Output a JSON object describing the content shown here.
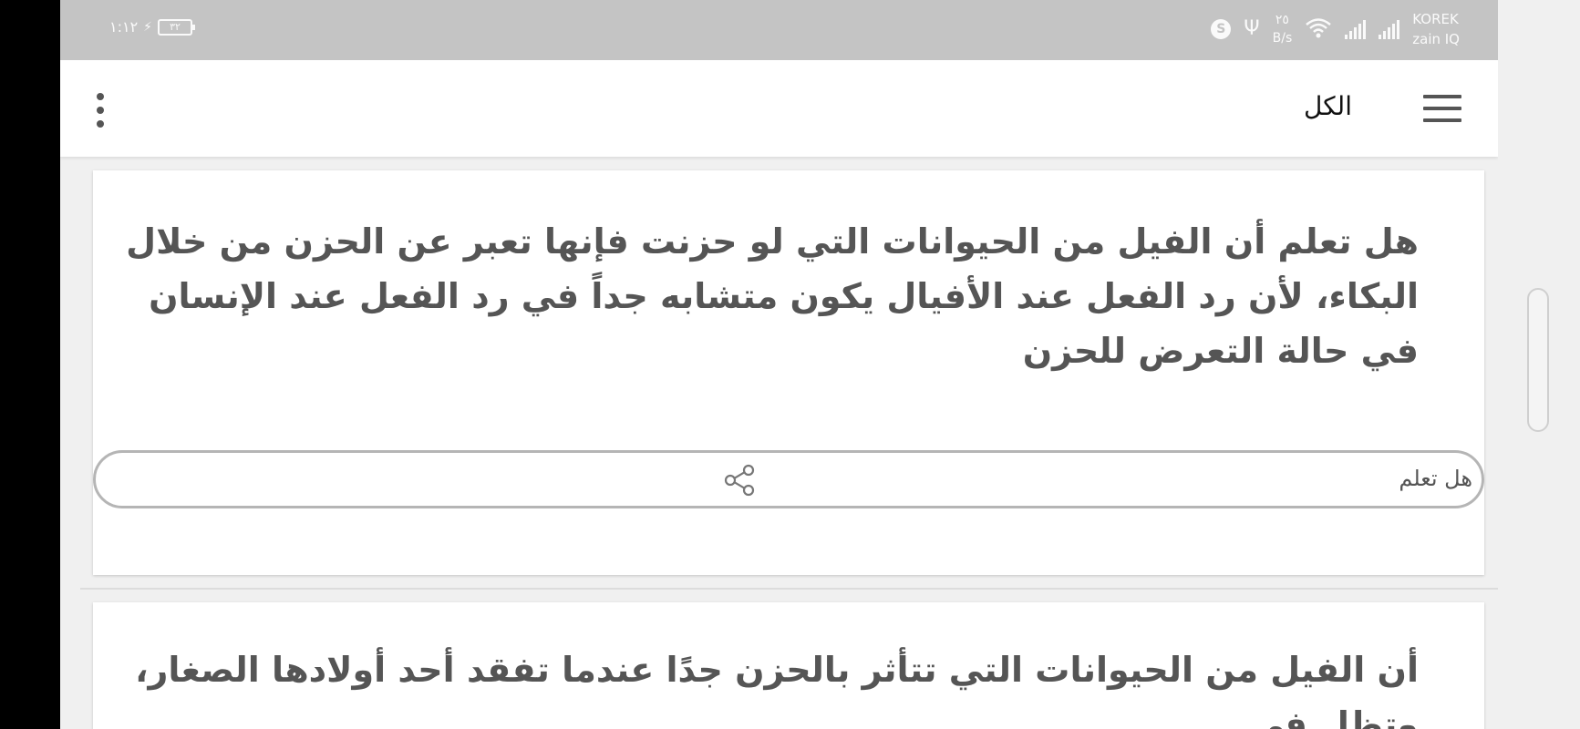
{
  "status_bar": {
    "time": "١:١٢",
    "battery": "٣٢",
    "carrier1": "KOREK",
    "carrier2": "zain IQ",
    "net_speed_value": "٢٥",
    "net_speed_unit": "B/s",
    "icons": [
      "charging-icon",
      "signal-icon",
      "signal-icon",
      "wifi-icon",
      "usb-icon",
      "skype-icon"
    ]
  },
  "app_bar": {
    "title": "الكل",
    "icons": [
      "menu-icon",
      "more-vert-icon"
    ]
  },
  "cards": [
    {
      "text": "هل تعلم أن الفيل من الحيوانات التي لو حزنت فإنها تعبر عن الحزن من خلال البكاء، لأن رد الفعل عند الأفيال يكون متشابه جداً في رد الفعل عند الإنسان في حالة التعرض للحزن",
      "category": "هل تعلم",
      "share_icon": "share-icon"
    },
    {
      "text": "أن الفيل من الحيوانات التي تتأثر بالحزن جدًا عندما تفقد أحد أولادها الصغار، وتظل في"
    }
  ],
  "colors": {
    "status_bar_bg": "#c4c4c4",
    "background": "#f0f0f0",
    "card_text": "#555555",
    "pill_border": "#b5b5b5"
  }
}
